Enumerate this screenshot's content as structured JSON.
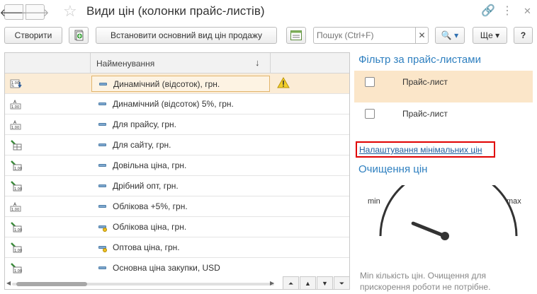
{
  "window": {
    "title": "Види цін (колонки прайс-листів)",
    "back_glyph": "🡐",
    "forward_glyph": "🡒",
    "favorite_glyph": "☆",
    "link_glyph": "🔗",
    "menu_glyph": "⋮",
    "restore_glyph": "▭",
    "close_glyph": "✕"
  },
  "toolbar": {
    "create_label": "Створити",
    "set_main_price_label": "Встановити основний вид цін продажу",
    "search_placeholder": "Пошук (Ctrl+F)",
    "search_clear_glyph": "✕",
    "search_button_glyph": "🔍 ▾",
    "more_label": "Ще ▾",
    "help_label": "?"
  },
  "table": {
    "column_name_header": "Найменування",
    "sort_glyph": "↓",
    "rows": [
      {
        "name": "Динамічний (відсоток), грн.",
        "row_icon": "price-percent-edit-icon",
        "marker": "dash",
        "warning": true,
        "selected": true
      },
      {
        "name": "Динамічний (відсоток) 5%, грн.",
        "row_icon": "price-formula-icon",
        "marker": "dash",
        "warning": false,
        "selected": false
      },
      {
        "name": "Для прайсу, грн.",
        "row_icon": "price-formula-icon",
        "marker": "dash",
        "warning": false,
        "selected": false
      },
      {
        "name": "Для сайту, грн.",
        "row_icon": "price-table-icon",
        "marker": "dash",
        "warning": false,
        "selected": false
      },
      {
        "name": "Довільна ціна, грн.",
        "row_icon": "price-manual-icon",
        "marker": "dash",
        "warning": false,
        "selected": false
      },
      {
        "name": "Дрібний опт, грн.",
        "row_icon": "price-manual-icon",
        "marker": "dash",
        "warning": false,
        "selected": false
      },
      {
        "name": "Облікова +5%, грн.",
        "row_icon": "price-formula-icon",
        "marker": "dash",
        "warning": false,
        "selected": false
      },
      {
        "name": "Облікова ціна, грн.",
        "row_icon": "price-manual-icon",
        "marker": "dash-dot",
        "warning": false,
        "selected": false
      },
      {
        "name": "Оптова ціна, грн.",
        "row_icon": "price-manual-icon",
        "marker": "dash-dot",
        "warning": false,
        "selected": false
      },
      {
        "name": "Основна ціна закупки, USD",
        "row_icon": "price-manual-icon",
        "marker": "dash",
        "warning": false,
        "selected": false
      }
    ],
    "nav_first_glyph": "⏶",
    "nav_up_glyph": "▲",
    "nav_down_glyph": "▼",
    "nav_last_glyph": "⏷"
  },
  "filter": {
    "title": "Фільтр за прайс-листами",
    "items": [
      {
        "label": "Прайс-лист",
        "checked": false,
        "selected": true
      },
      {
        "label": "Прайс-лист",
        "checked": false,
        "selected": false
      }
    ]
  },
  "min_price_settings": {
    "link_label": "Налаштування мінімальних цін"
  },
  "cleanup": {
    "title": "Очищення цін",
    "gauge_min_label": "min",
    "gauge_max_label": "max",
    "gauge_level": 0.12,
    "footnote": "Min кількість цін. Очищення для прискорення роботи не потрібне."
  },
  "colors": {
    "accent_blue": "#2f80c0",
    "selection": "#fbecd6",
    "highlight_red": "#e00000",
    "link": "#1e5fa0"
  }
}
